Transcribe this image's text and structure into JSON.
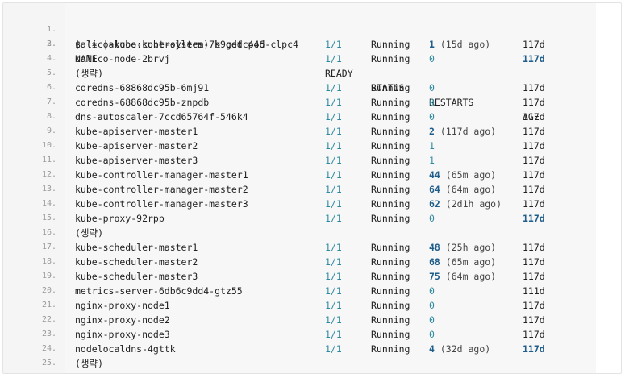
{
  "code": {
    "line_numbers": [
      "1.",
      "2.",
      "3.",
      "4.",
      "5.",
      "6.",
      "7.",
      "8.",
      "9.",
      "10.",
      "11.",
      "12.",
      "13.",
      "14.",
      "15.",
      "16.",
      "17.",
      "18.",
      "19.",
      "20.",
      "21.",
      "22.",
      "23.",
      "24.",
      "25."
    ],
    "command": "$ (⎈ |alooo:kube-system) k get pod",
    "header": {
      "name": "NAME",
      "ready": "READY",
      "status": "STATUS",
      "restarts": "RESTARTS",
      "age": "AGE"
    },
    "omitted_label": "(생략)",
    "rows": [
      {
        "line": 3,
        "name": "calico-kube-controllers-7b9cddc446-clpc4",
        "ready": "1/1",
        "status": "Running",
        "restarts": "1",
        "ago": "(15d ago)",
        "age": "117d",
        "restarts_bold": true,
        "age_bold": false
      },
      {
        "line": 4,
        "name": "calico-node-2brvj",
        "ready": "1/1",
        "status": "Running",
        "restarts": "0",
        "ago": "",
        "age": "117d",
        "restarts_bold": false,
        "age_bold": true
      },
      {
        "line": 6,
        "name": "coredns-68868dc95b-6mj91",
        "ready": "1/1",
        "status": "Running",
        "restarts": "0",
        "ago": "",
        "age": "117d",
        "restarts_bold": false,
        "age_bold": false
      },
      {
        "line": 7,
        "name": "coredns-68868dc95b-znpdb",
        "ready": "1/1",
        "status": "Running",
        "restarts": "0",
        "ago": "",
        "age": "117d",
        "restarts_bold": false,
        "age_bold": false
      },
      {
        "line": 8,
        "name": "dns-autoscaler-7ccd65764f-546k4",
        "ready": "1/1",
        "status": "Running",
        "restarts": "0",
        "ago": "",
        "age": "117d",
        "restarts_bold": false,
        "age_bold": false
      },
      {
        "line": 9,
        "name": "kube-apiserver-master1",
        "ready": "1/1",
        "status": "Running",
        "restarts": "2",
        "ago": "(117d ago)",
        "age": "117d",
        "restarts_bold": true,
        "age_bold": false
      },
      {
        "line": 10,
        "name": "kube-apiserver-master2",
        "ready": "1/1",
        "status": "Running",
        "restarts": "1",
        "ago": "",
        "age": "117d",
        "restarts_bold": false,
        "age_bold": false
      },
      {
        "line": 11,
        "name": "kube-apiserver-master3",
        "ready": "1/1",
        "status": "Running",
        "restarts": "1",
        "ago": "",
        "age": "117d",
        "restarts_bold": false,
        "age_bold": false
      },
      {
        "line": 12,
        "name": "kube-controller-manager-master1",
        "ready": "1/1",
        "status": "Running",
        "restarts": "44",
        "ago": "(65m ago)",
        "age": "117d",
        "restarts_bold": true,
        "age_bold": false
      },
      {
        "line": 13,
        "name": "kube-controller-manager-master2",
        "ready": "1/1",
        "status": "Running",
        "restarts": "64",
        "ago": "(64m ago)",
        "age": "117d",
        "restarts_bold": true,
        "age_bold": false
      },
      {
        "line": 14,
        "name": "kube-controller-manager-master3",
        "ready": "1/1",
        "status": "Running",
        "restarts": "62",
        "ago": "(2d1h ago)",
        "age": "117d",
        "restarts_bold": true,
        "age_bold": false
      },
      {
        "line": 15,
        "name": "kube-proxy-92rpp",
        "ready": "1/1",
        "status": "Running",
        "restarts": "0",
        "ago": "",
        "age": "117d",
        "restarts_bold": false,
        "age_bold": true
      },
      {
        "line": 17,
        "name": "kube-scheduler-master1",
        "ready": "1/1",
        "status": "Running",
        "restarts": "48",
        "ago": "(25h ago)",
        "age": "117d",
        "restarts_bold": true,
        "age_bold": false
      },
      {
        "line": 18,
        "name": "kube-scheduler-master2",
        "ready": "1/1",
        "status": "Running",
        "restarts": "68",
        "ago": "(65m ago)",
        "age": "117d",
        "restarts_bold": true,
        "age_bold": false
      },
      {
        "line": 19,
        "name": "kube-scheduler-master3",
        "ready": "1/1",
        "status": "Running",
        "restarts": "75",
        "ago": "(64m ago)",
        "age": "117d",
        "restarts_bold": true,
        "age_bold": false
      },
      {
        "line": 20,
        "name": "metrics-server-6db6c9dd4-gtz55",
        "ready": "1/1",
        "status": "Running",
        "restarts": "0",
        "ago": "",
        "age": "111d",
        "restarts_bold": false,
        "age_bold": false
      },
      {
        "line": 21,
        "name": "nginx-proxy-node1",
        "ready": "1/1",
        "status": "Running",
        "restarts": "0",
        "ago": "",
        "age": "117d",
        "restarts_bold": false,
        "age_bold": false
      },
      {
        "line": 22,
        "name": "nginx-proxy-node2",
        "ready": "1/1",
        "status": "Running",
        "restarts": "0",
        "ago": "",
        "age": "117d",
        "restarts_bold": false,
        "age_bold": false
      },
      {
        "line": 23,
        "name": "nginx-proxy-node3",
        "ready": "1/1",
        "status": "Running",
        "restarts": "0",
        "ago": "",
        "age": "117d",
        "restarts_bold": false,
        "age_bold": false
      },
      {
        "line": 24,
        "name": "nodelocaldns-4gttk",
        "ready": "1/1",
        "status": "Running",
        "restarts": "4",
        "ago": "(32d ago)",
        "age": "117d",
        "restarts_bold": true,
        "age_bold": true
      }
    ]
  },
  "colors": {
    "number": "#2f8aa0",
    "bold_number": "#1f5d8a",
    "gutter_bg": "#f5f5f5",
    "code_bg": "#f7f7f7"
  }
}
